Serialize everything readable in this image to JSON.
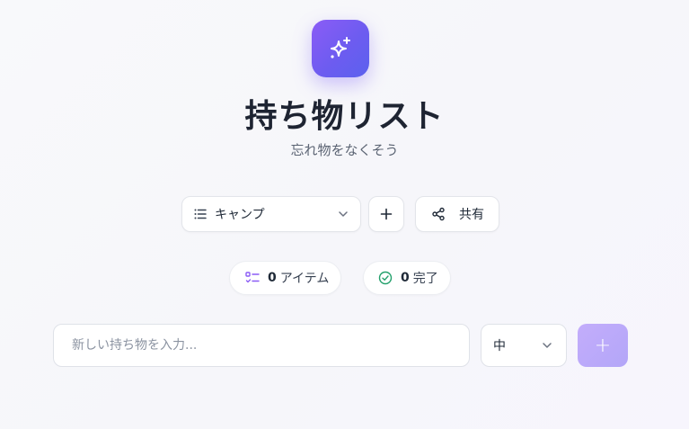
{
  "header": {
    "title": "持ち物リスト",
    "subtitle": "忘れ物をなくそう",
    "logo_icon": "sparkles-icon"
  },
  "toolbar": {
    "list_select_value": "キャンプ",
    "share_label": "共有"
  },
  "stats": {
    "items_count": "0",
    "items_label": "アイテム",
    "done_count": "0",
    "done_label": "完了"
  },
  "add_form": {
    "placeholder": "新しい持ち物を入力...",
    "priority_value": "中",
    "add_button_label": "+"
  },
  "colors": {
    "accent": "#7c5cf6",
    "success": "#22a06b",
    "text": "#1e2432"
  }
}
